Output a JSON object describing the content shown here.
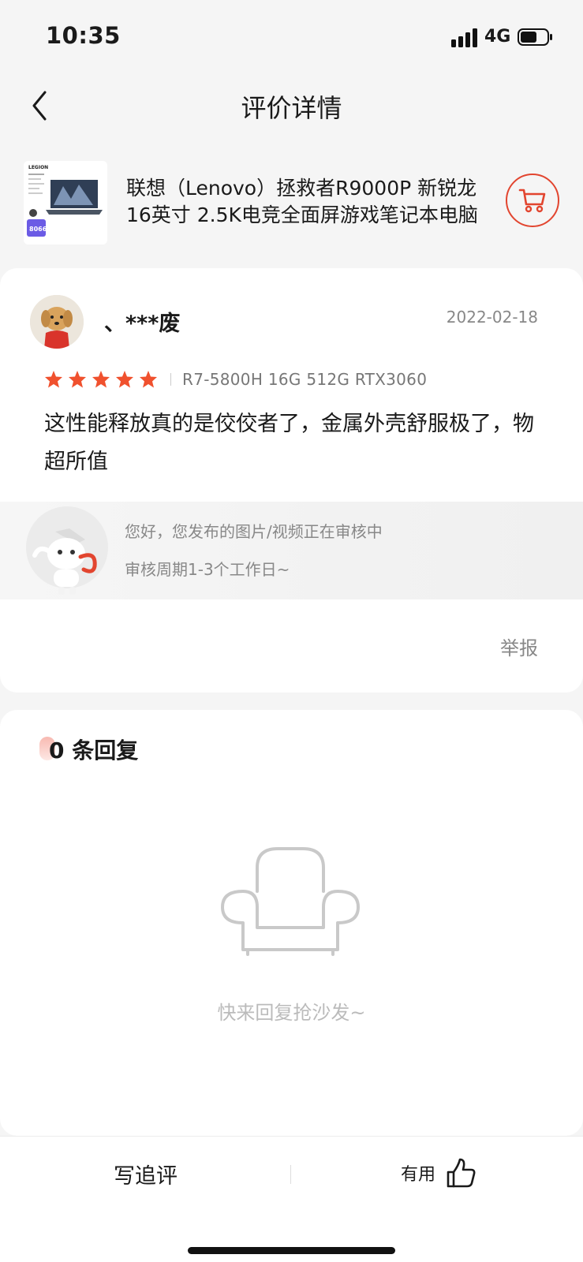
{
  "status_bar": {
    "time": "10:35",
    "network": "4G",
    "icons": [
      "signal-icon",
      "battery-icon"
    ]
  },
  "nav": {
    "title": "评价详情",
    "back_icon": "chevron-left-icon"
  },
  "product": {
    "name": "联想（Lenovo）拯救者R9000P 新锐龙 16英寸 2.5K电竞全面屏游戏笔记本电脑",
    "thumb_brand": "LEGION",
    "thumb_price": "8066",
    "cart_icon": "cart-icon"
  },
  "review": {
    "username": "、***废",
    "date": "2022-02-18",
    "rating": 5,
    "rating_max": 5,
    "spec": "R7-5800H 16G 512G RTX3060",
    "content": "这性能释放真的是佼佼者了，金属外壳舒服极了，物超所值",
    "media_notice_line1": "您好，您发布的图片/视频正在审核中",
    "media_notice_line2": "审核周期1-3个工作日~",
    "report_label": "举报"
  },
  "replies": {
    "count_label": "0 条回复",
    "empty_text": "快来回复抢沙发~",
    "empty_icon": "sofa-icon"
  },
  "bottom_bar": {
    "write_followup_label": "写追评",
    "useful_label": "有用",
    "useful_icon": "thumbs-up-icon"
  },
  "colors": {
    "accent": "#e2452f",
    "star": "#f0512e",
    "background": "#f5f5f5"
  }
}
